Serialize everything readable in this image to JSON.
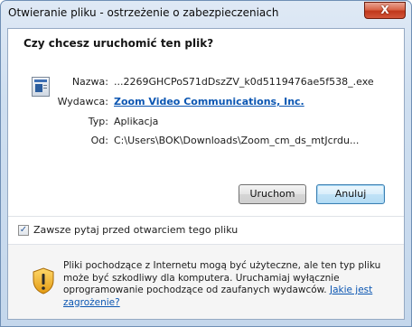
{
  "window": {
    "title": "Otwieranie pliku - ostrzeżenie o zabezpieczeniach",
    "close_label": "X"
  },
  "dialog": {
    "question": "Czy chcesz uruchomić ten plik?",
    "file_icon": "application-icon",
    "fields": {
      "name_label": "Nazwa:",
      "name_value": "...2269GHCPoS71dDszZV_k0d5119476ae5f538_.exe",
      "publisher_label": "Wydawca:",
      "publisher_value": "Zoom Video Communications, Inc.",
      "type_label": "Typ:",
      "type_value": "Aplikacja",
      "from_label": "Od:",
      "from_value": "C:\\Users\\BOK\\Downloads\\Zoom_cm_ds_mtJcrdu..."
    },
    "buttons": {
      "run": "Uruchom",
      "cancel": "Anuluj"
    },
    "checkbox": {
      "label": "Zawsze pytaj przed otwarciem tego pliku",
      "checked": true
    },
    "warning": {
      "icon": "shield-warning-icon",
      "text_part1": "Pliki pochodzące z Internetu mogą być użyteczne, ale ten typ pliku może być szkodliwy dla komputera. Uruchamiaj wyłącznie oprogramowanie pochodzące od zaufanych wydawców. ",
      "link": "Jakie jest zagrożenie?"
    }
  },
  "colors": {
    "accent_link": "#0b56b2",
    "close_button": "#c7432a",
    "frame": "#c4d7ec"
  }
}
